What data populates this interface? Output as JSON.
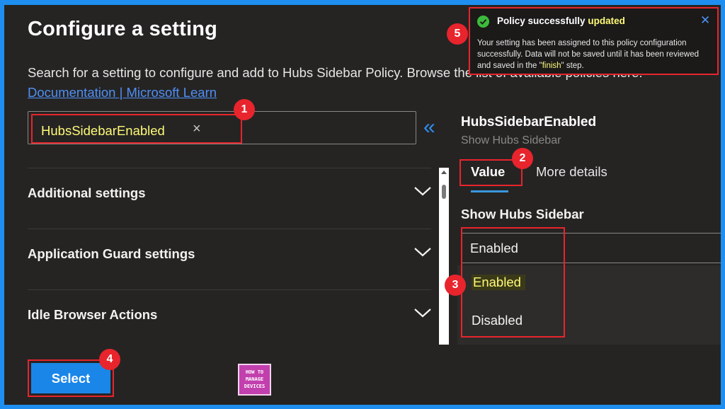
{
  "page": {
    "title": "Configure a setting",
    "description": "Search for a setting to configure and add to Hubs Sidebar Policy. Browse the list of available policies here:",
    "doc_link": "Documentation | Microsoft Learn"
  },
  "search": {
    "chip_value": "HubsSidebarEnabled",
    "clear_icon": "×",
    "collapse_icon": "«"
  },
  "categories": [
    {
      "label": "Additional settings"
    },
    {
      "label": "Application Guard settings"
    },
    {
      "label": "Idle Browser Actions"
    }
  ],
  "setting": {
    "name": "HubsSidebarEnabled",
    "subtitle": "Show Hubs Sidebar",
    "tabs": [
      "Value",
      "More details"
    ],
    "field_label": "Show Hubs Sidebar",
    "selected_value": "Enabled",
    "options": [
      "Enabled",
      "Disabled"
    ]
  },
  "footer": {
    "select_label": "Select",
    "logo_lines": [
      "HOW TO",
      "MANAGE",
      "DEVICES"
    ]
  },
  "badges": [
    "1",
    "2",
    "3",
    "4",
    "5"
  ],
  "toast": {
    "title_prefix": "Policy successfully",
    "title_highlight": "updated",
    "body_part1": "Your setting has been assigned to this policy configuration successfully. Data will not be saved until it has been reviewed and saved in the \"",
    "body_highlight": "finish",
    "body_part2": "\" step.",
    "close_icon": "✕"
  },
  "colors": {
    "background_blue": "#1e8ff0",
    "panel": "#252423",
    "annotation_red": "#e8242c",
    "highlight_yellow": "#fffa78",
    "primary_button": "#1a86e8"
  }
}
